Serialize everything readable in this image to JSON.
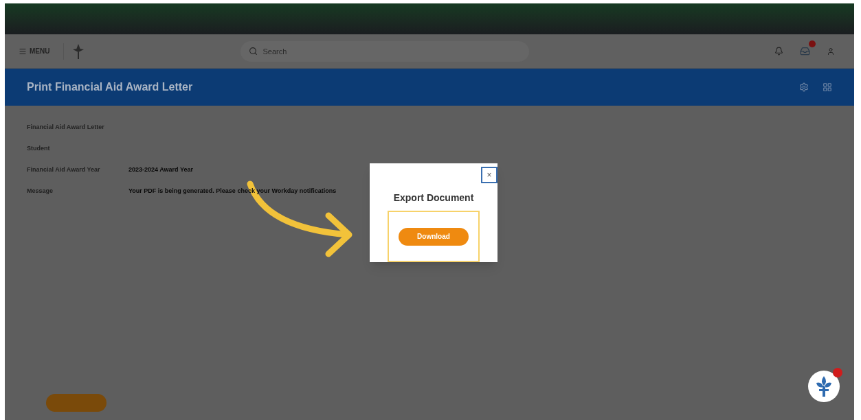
{
  "nav": {
    "menu_label": "MENU",
    "search": {
      "placeholder": "Search"
    }
  },
  "page_header": {
    "title": "Print Financial Aid Award Letter"
  },
  "fields": [
    {
      "label": "Financial Aid Award Letter"
    },
    {
      "label": "Student"
    },
    {
      "label": "Financial Aid Award Year",
      "value": "2023-2024 Award Year"
    },
    {
      "label": "Message",
      "value": "Your PDF is being generated. Please check your Workday notifications"
    }
  ],
  "dialog": {
    "title": "Export Document",
    "close": "×",
    "button": "Download"
  }
}
